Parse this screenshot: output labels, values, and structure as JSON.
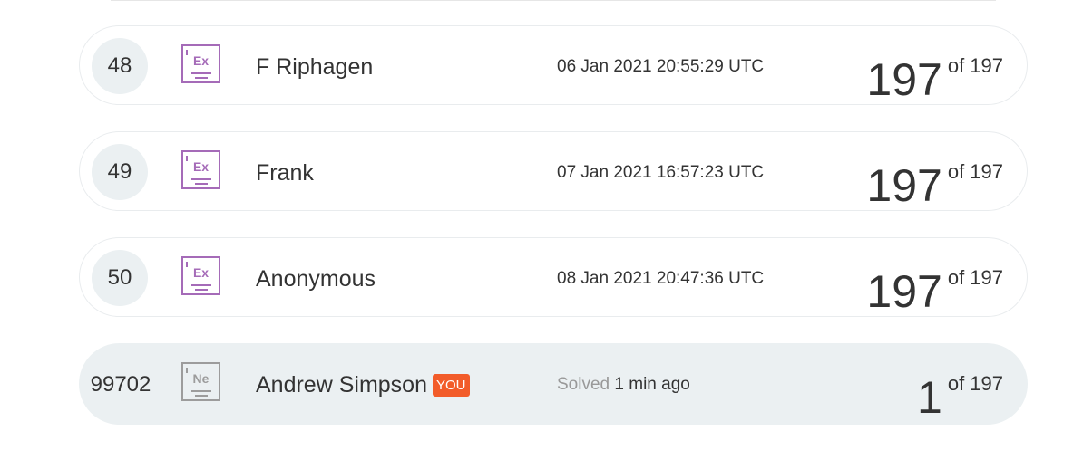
{
  "leaderboard": {
    "rows": [
      {
        "rank": "48",
        "badge_symbol": "Ex",
        "name": "F Riphagen",
        "date": "06 Jan 2021 20:55:29 UTC",
        "score": "197",
        "of_text": "of 197"
      },
      {
        "rank": "49",
        "badge_symbol": "Ex",
        "name": "Frank",
        "date": "07 Jan 2021 16:57:23 UTC",
        "score": "197",
        "of_text": "of 197"
      },
      {
        "rank": "50",
        "badge_symbol": "Ex",
        "name": "Anonymous",
        "date": "08 Jan 2021 20:47:36 UTC",
        "score": "197",
        "of_text": "of 197"
      }
    ],
    "current_user": {
      "rank": "99702",
      "badge_symbol": "Ne",
      "name": "Andrew Simpson",
      "you_label": "YOU",
      "solved_label": "Solved",
      "solved_time": "1 min ago",
      "score": "1",
      "of_text": "of 197"
    }
  },
  "colors": {
    "badge_purple": "#a56bb8",
    "badge_grey": "#9c9c9c",
    "you_tag": "#f25c2a",
    "current_row_bg": "#ebf0f2"
  },
  "icons": {
    "expert_badge": "expert-badge-icon",
    "novice_badge": "neophyte-badge-icon"
  }
}
